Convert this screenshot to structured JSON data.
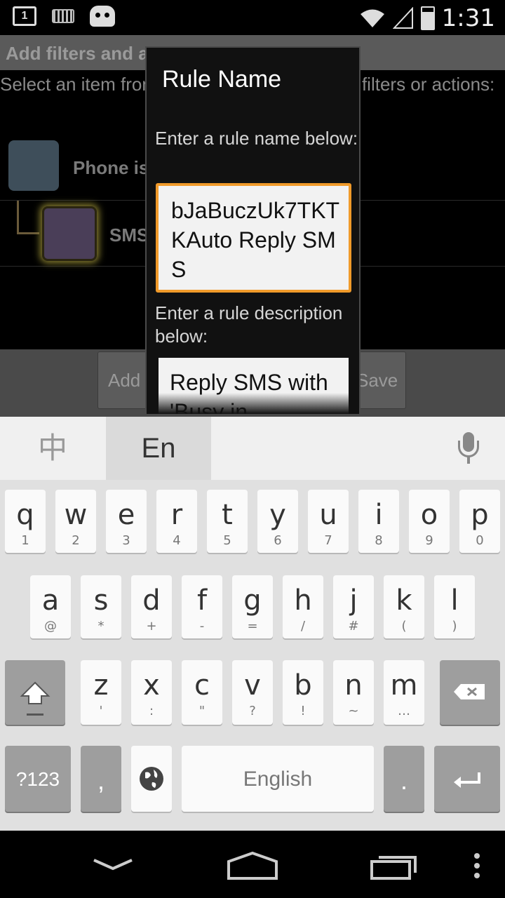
{
  "status_bar": {
    "time": "1:31",
    "notification_count": "1",
    "icons": [
      "notification-icon",
      "keyboard-icon",
      "cyanogen-icon",
      "wifi-icon",
      "signal-icon",
      "battery-icon"
    ]
  },
  "app": {
    "title": "Add filters and actions to your rule",
    "instructions": "Select an item from the tree below, then add filters or actions:",
    "tree": [
      {
        "label": "Phone is ringing"
      },
      {
        "label": "SMS"
      }
    ],
    "buttons": {
      "add_label": "Add F",
      "save_label": "Save"
    }
  },
  "dialog": {
    "title": "Rule Name",
    "name_prompt": "Enter a rule name below:",
    "name_value": "bJaBuczUk7TKTKAuto Reply SMS",
    "description_prompt": "Enter a rule description below:",
    "description_value": "Reply SMS with 'Busy in"
  },
  "keyboard": {
    "lang_zh": "中",
    "lang_en": "En",
    "row1": [
      {
        "k": "q",
        "s": "1"
      },
      {
        "k": "w",
        "s": "2"
      },
      {
        "k": "e",
        "s": "3"
      },
      {
        "k": "r",
        "s": "4"
      },
      {
        "k": "t",
        "s": "5"
      },
      {
        "k": "y",
        "s": "6"
      },
      {
        "k": "u",
        "s": "7"
      },
      {
        "k": "i",
        "s": "8"
      },
      {
        "k": "o",
        "s": "9"
      },
      {
        "k": "p",
        "s": "0"
      }
    ],
    "row2": [
      {
        "k": "a",
        "s": "@"
      },
      {
        "k": "s",
        "s": "*"
      },
      {
        "k": "d",
        "s": "+"
      },
      {
        "k": "f",
        "s": "-"
      },
      {
        "k": "g",
        "s": "="
      },
      {
        "k": "h",
        "s": "/"
      },
      {
        "k": "j",
        "s": "#"
      },
      {
        "k": "k",
        "s": "("
      },
      {
        "k": "l",
        "s": ")"
      }
    ],
    "row3": [
      {
        "k": "z",
        "s": "'"
      },
      {
        "k": "x",
        "s": ":"
      },
      {
        "k": "c",
        "s": "\""
      },
      {
        "k": "v",
        "s": "?"
      },
      {
        "k": "b",
        "s": "!"
      },
      {
        "k": "n",
        "s": "~"
      },
      {
        "k": "m",
        "s": "…"
      }
    ],
    "symbols_label": "?123",
    "comma": ",",
    "space_label": "English",
    "period": "."
  },
  "colors": {
    "field_focus_border": "#f09a2a",
    "dialog_bg": "#111111",
    "keyboard_bg": "#e0e0e0"
  }
}
